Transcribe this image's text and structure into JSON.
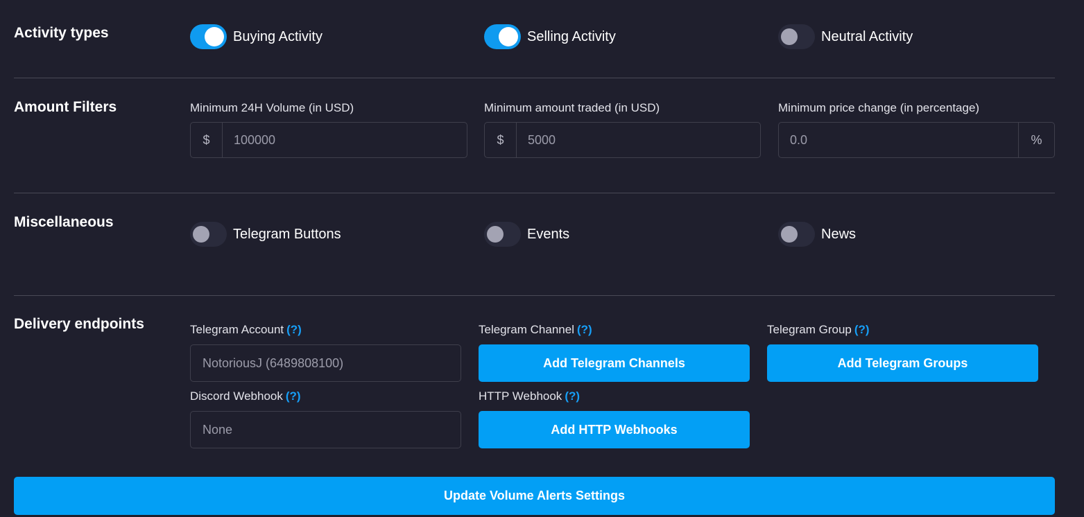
{
  "activity_types": {
    "title": "Activity types",
    "toggles": [
      {
        "label": "Buying Activity",
        "on": true
      },
      {
        "label": "Selling Activity",
        "on": true
      },
      {
        "label": "Neutral Activity",
        "on": false
      }
    ]
  },
  "amount_filters": {
    "title": "Amount Filters",
    "min_volume": {
      "label": "Minimum 24H Volume (in USD)",
      "prefix": "$",
      "placeholder": "100000"
    },
    "min_traded": {
      "label": "Minimum amount traded (in USD)",
      "prefix": "$",
      "placeholder": "5000"
    },
    "min_price_change": {
      "label": "Minimum price change (in percentage)",
      "suffix": "%",
      "placeholder": "0.0"
    }
  },
  "miscellaneous": {
    "title": "Miscellaneous",
    "toggles": [
      {
        "label": "Telegram Buttons",
        "on": false
      },
      {
        "label": "Events",
        "on": false
      },
      {
        "label": "News",
        "on": false
      }
    ]
  },
  "delivery": {
    "title": "Delivery endpoints",
    "help": "(?)",
    "telegram_account": {
      "label": "Telegram Account",
      "placeholder": "NotoriousJ (6489808100)"
    },
    "telegram_channel": {
      "label": "Telegram Channel",
      "button": "Add Telegram Channels"
    },
    "telegram_group": {
      "label": "Telegram Group",
      "button": "Add Telegram Groups"
    },
    "discord_webhook": {
      "label": "Discord Webhook",
      "placeholder": "None"
    },
    "http_webhook": {
      "label": "HTTP Webhook",
      "button": "Add HTTP Webhooks"
    }
  },
  "submit": {
    "label": "Update Volume Alerts Settings"
  },
  "colors": {
    "background": "#1f1f2d",
    "accent": "#039ff5",
    "toggle_on": "#0f9bf0",
    "toggle_off": "#2a2b3c",
    "divider": "#4a4a56",
    "help_link": "#179ff7"
  }
}
